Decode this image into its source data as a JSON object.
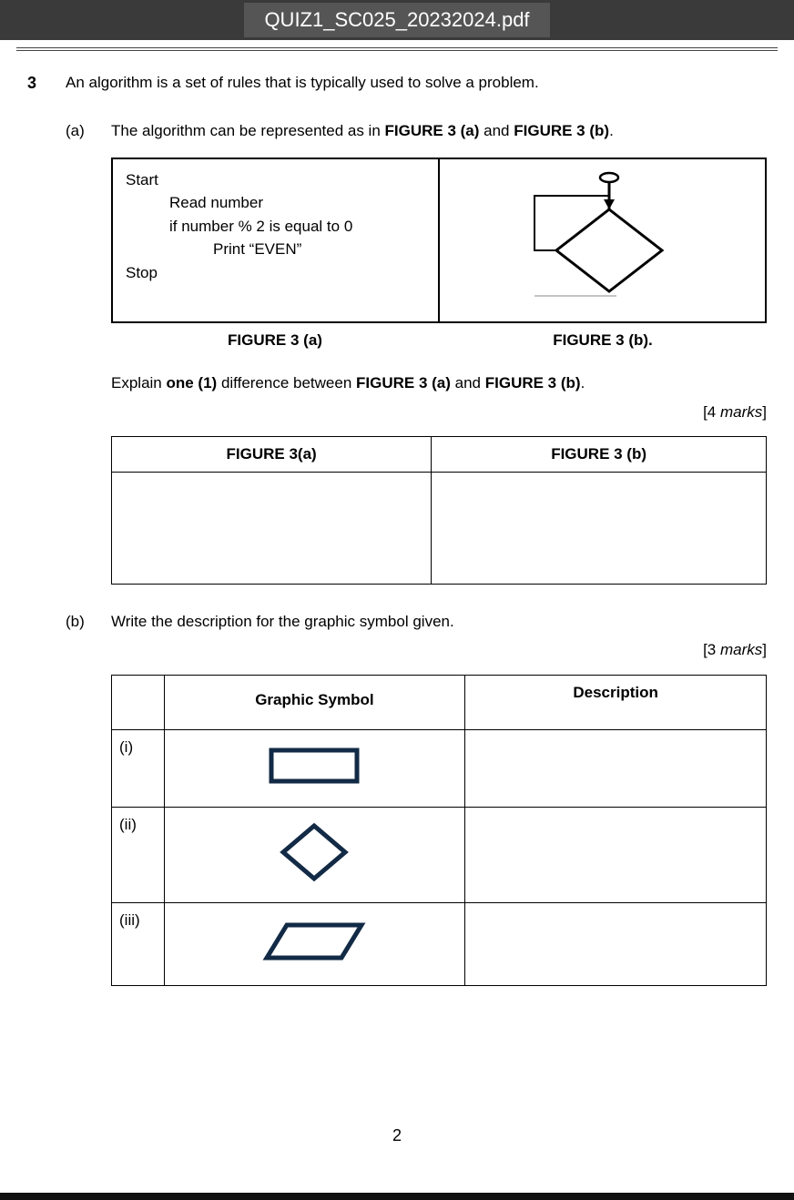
{
  "titlebar": {
    "filename": "QUIZ1_SC025_20232024.pdf"
  },
  "question": {
    "number": "3",
    "stem": "An algorithm is a set of rules that is typically used to solve a problem."
  },
  "partA": {
    "label": "(a)",
    "intro_pre": "The algorithm can be represented as in ",
    "fig_a_bold": "FIGURE 3 (a)",
    "intro_mid": " and ",
    "fig_b_bold": "FIGURE 3 (b)",
    "intro_post": ".",
    "pseudo": {
      "l1": "Start",
      "l2": "Read number",
      "l3": "if number % 2 is equal to 0",
      "l4": "Print “EVEN”",
      "l5": "Stop"
    },
    "cap_a": "FIGURE 3 (a)",
    "cap_b": "FIGURE 3 (b).",
    "explain_pre": "Explain ",
    "explain_bold": "one (1)",
    "explain_mid": " difference between ",
    "explain_b1": "FIGURE 3 (a)",
    "explain_and": " and ",
    "explain_b2": "FIGURE 3 (b)",
    "explain_post": ".",
    "marks": "[4 marks]",
    "ans_head_a": "FIGURE 3(a)",
    "ans_head_b": "FIGURE 3 (b)"
  },
  "partB": {
    "label": "(b)",
    "text": "Write the description for the graphic symbol given.",
    "marks": "[3 marks]",
    "head_sym": "Graphic Symbol",
    "head_desc": "Description",
    "rows": {
      "r1": "(i)",
      "r2": "(ii)",
      "r3": "(iii)"
    }
  },
  "footer": {
    "page_number": "2"
  }
}
